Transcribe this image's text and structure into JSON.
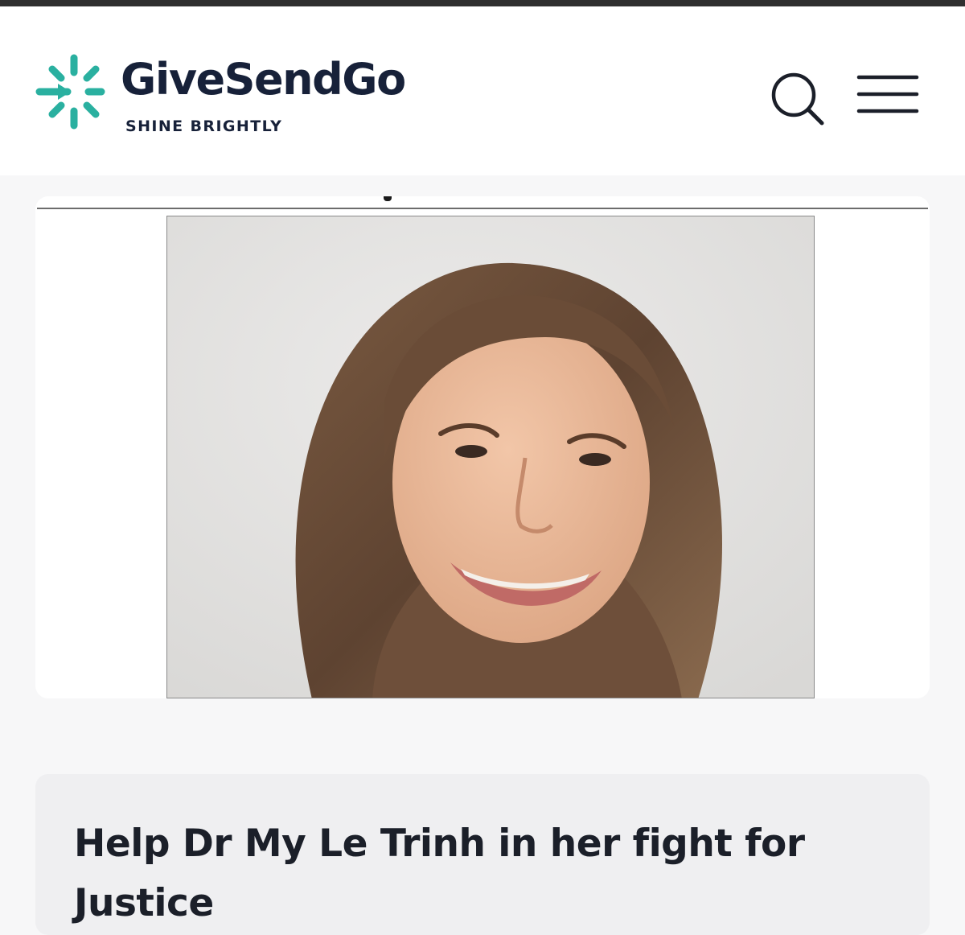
{
  "header": {
    "brand_name": "GiveSendGo",
    "tagline": "SHINE BRIGHTLY",
    "brand_color": "#2ab0a0",
    "text_color": "#172139",
    "search_icon": "search-icon",
    "menu_icon": "hamburger-menu-icon"
  },
  "campaign": {
    "image": "campaign-photo",
    "title": "Help Dr My Le Trinh in her fight for Justice"
  }
}
